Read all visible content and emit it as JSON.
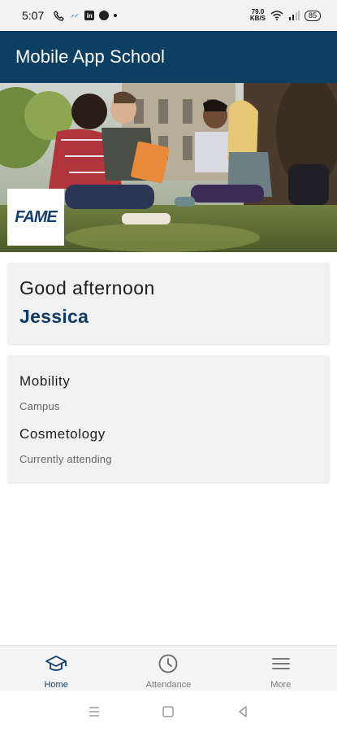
{
  "status_bar": {
    "time": "5:07",
    "net_speed_top": "79.0",
    "net_speed_bottom": "KB/S",
    "battery": "85",
    "linkedin_glyph": "in",
    "icons": [
      "call-icon",
      "messenger-icon",
      "linkedin-icon",
      "whatsapp-icon",
      "dot-icon",
      "wifi-icon",
      "signal-icon",
      "battery-icon"
    ]
  },
  "app_bar": {
    "title": "Mobile App School"
  },
  "hero": {
    "logo_text": "FAME"
  },
  "greeting_card": {
    "greeting": "Good afternoon",
    "name": "Jessica"
  },
  "info_card": {
    "items": [
      {
        "title": "Mobility",
        "subtitle": "Campus"
      },
      {
        "title": "Cosmetology",
        "subtitle": "Currently attending"
      }
    ]
  },
  "bottom_nav": {
    "items": [
      {
        "label": "Home",
        "icon": "graduation-cap-icon",
        "active": true
      },
      {
        "label": "Attendance",
        "icon": "clock-icon",
        "active": false
      },
      {
        "label": "More",
        "icon": "menu-icon",
        "active": false
      }
    ]
  },
  "colors": {
    "primary": "#0c3f62",
    "accent_name": "#103a66",
    "card_bg": "#f1f1f1"
  }
}
